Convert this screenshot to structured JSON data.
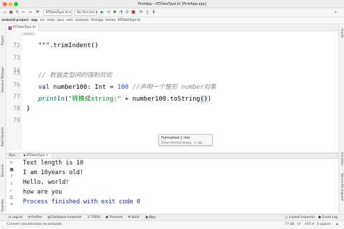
{
  "window": {
    "title": "FirstApp – KTDataType.kt [FirstApp.app]"
  },
  "toolbar": {
    "config": "KTDataType.kt",
    "device": "No Devices"
  },
  "breadcrumb": [
    "android-project",
    "app",
    "src",
    "main",
    "java",
    "com",
    "example",
    "firstapp",
    "lesson",
    "KTDataType.kt"
  ],
  "tab": {
    "label": "KTDataType.kt"
  },
  "editor": {
    "fold_label": "main()",
    "lines": [
      {
        "num": "72",
        "text": "\"\"\".trimIndent()"
      },
      {
        "num": "73",
        "text": ""
      },
      {
        "num": "74",
        "text": ""
      },
      {
        "num": "75",
        "comment": "// 数据类型间的强制欢欢"
      },
      {
        "num": "76",
        "kw": "val",
        "name": " number100: ",
        "type": "Int",
        "eq": " = ",
        "value": "100",
        "comment": "   //声明一个整形 number对象"
      },
      {
        "num": "77",
        "fn": "println",
        "str": "\"转换成string:\"",
        "rest": " + number100.toString",
        "paren": "()",
        "close": ")"
      },
      {
        "num": "78",
        "text": "}"
      },
      {
        "num": "79",
        "text": ""
      }
    ]
  },
  "tooltip": {
    "title": "Formatted 1 line",
    "hint": "Show reformat dialog: ⌥⇧⌘L"
  },
  "left_panels": [
    "Project",
    "Resource Manager",
    "Structure",
    "Build Variants",
    "Favorites"
  ],
  "right_panels": [
    "Gradle",
    "Emulator",
    "Device File Explorer"
  ],
  "run": {
    "label": "Run:",
    "config": "KTDataType"
  },
  "console": {
    "lines": [
      "Text length is 10",
      "I am 10years old!",
      "Hello, world!",
      "how are you"
    ],
    "finished": "Process finished with exit code 0"
  },
  "bottom_tools": [
    "Logcat",
    "Profiler",
    "Database Inspector",
    "TODO",
    "Terminal",
    "Build",
    "Run"
  ],
  "bottom_right": [
    "Layout Inspector",
    "Event Log"
  ],
  "status": {
    "message": "Convert concatenation to template",
    "position": "77:48",
    "line_sep": "LF",
    "encoding": "UTF-8",
    "indent": "4 spaces"
  },
  "colors": {
    "keyword": "#0033b3",
    "string": "#067d17",
    "number": "#1750eb",
    "comment": "#8c8c8c",
    "function": "#00627a",
    "console_finish": "#1e1e9c"
  }
}
